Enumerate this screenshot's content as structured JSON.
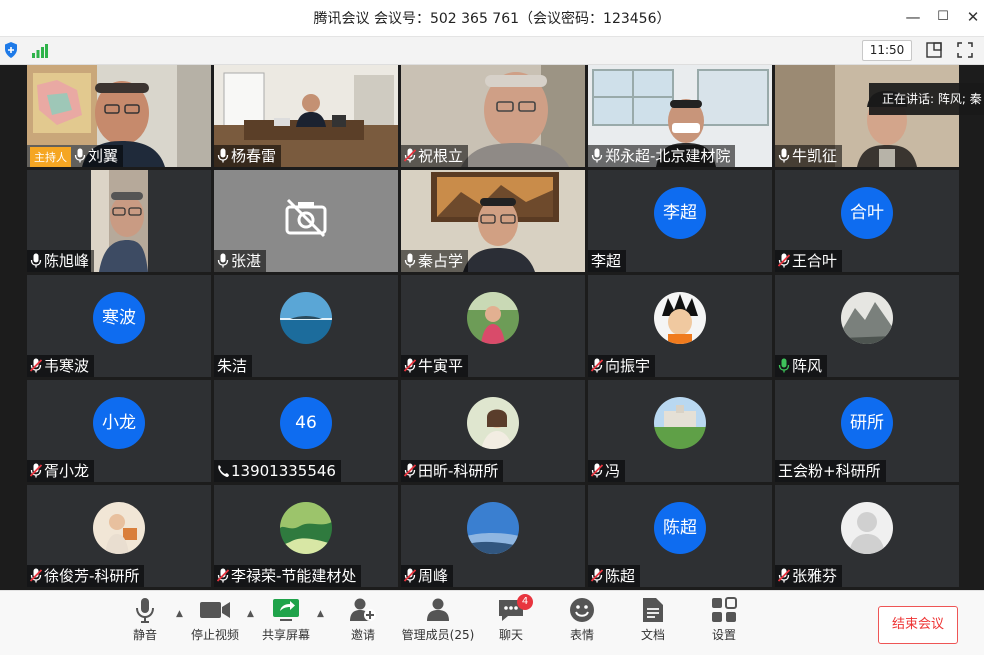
{
  "window": {
    "title": "腾讯会议 会议号：502 365 761（会议密码：123456）",
    "minimize": "—",
    "maximize": "☐",
    "close": "✕"
  },
  "infobar": {
    "time": "11:50"
  },
  "speaking_banner": "正在讲话: 阵风; 秦",
  "host_badge": "主持人",
  "tiles": [
    {
      "name": "刘翼",
      "mic": "on",
      "kind": "video",
      "scene": "office-map"
    },
    {
      "name": "杨春雷",
      "mic": "on",
      "kind": "video",
      "scene": "office-desk"
    },
    {
      "name": "祝根立",
      "mic": "muted",
      "kind": "video",
      "scene": "man-glasses"
    },
    {
      "name": "郑永超-北京建材院",
      "mic": "on",
      "kind": "video",
      "scene": "office-window"
    },
    {
      "name": "牛凯征",
      "mic": "on",
      "kind": "video",
      "scene": "man-room"
    },
    {
      "name": "陈旭峰",
      "mic": "on",
      "kind": "video",
      "scene": "man-shelf"
    },
    {
      "name": "张湛",
      "mic": "on",
      "kind": "camera-off"
    },
    {
      "name": "秦占学",
      "mic": "on",
      "kind": "video",
      "scene": "man-painting"
    },
    {
      "name": "李超",
      "mic": "none",
      "kind": "avatar",
      "avatar_text": "李超"
    },
    {
      "name": "王合叶",
      "mic": "muted",
      "kind": "avatar",
      "avatar_text": "合叶"
    },
    {
      "name": "韦寒波",
      "mic": "muted",
      "kind": "avatar",
      "avatar_text": "寒波"
    },
    {
      "name": "朱洁",
      "mic": "none",
      "kind": "photo",
      "photo": "lake"
    },
    {
      "name": "牛寅平",
      "mic": "muted",
      "kind": "photo",
      "photo": "girl"
    },
    {
      "name": "向振宇",
      "mic": "muted",
      "kind": "photo",
      "photo": "cartoon"
    },
    {
      "name": "阵风",
      "mic": "active",
      "kind": "photo",
      "photo": "mountain"
    },
    {
      "name": "胥小龙",
      "mic": "muted",
      "kind": "avatar",
      "avatar_text": "小龙"
    },
    {
      "name": "13901335546",
      "mic": "phone",
      "kind": "avatar",
      "avatar_text": "46"
    },
    {
      "name": "田昕-科研所",
      "mic": "muted",
      "kind": "photo",
      "photo": "woman"
    },
    {
      "name": "冯",
      "mic": "muted",
      "kind": "photo",
      "photo": "campus"
    },
    {
      "name": "王会粉+科研所",
      "mic": "none",
      "kind": "avatar",
      "avatar_text": "研所"
    },
    {
      "name": "徐俊芳-科研所",
      "mic": "muted",
      "kind": "photo",
      "photo": "child"
    },
    {
      "name": "李禄荣-节能建材处",
      "mic": "muted",
      "kind": "photo",
      "photo": "forest"
    },
    {
      "name": "周峰",
      "mic": "muted",
      "kind": "photo",
      "photo": "sky"
    },
    {
      "name": "陈超",
      "mic": "muted",
      "kind": "avatar",
      "avatar_text": "陈超"
    },
    {
      "name": "张雅芬",
      "mic": "muted",
      "kind": "photo",
      "photo": "default"
    }
  ],
  "toolbar": {
    "mute": "静音",
    "stop_video": "停止视频",
    "share_screen": "共享屏幕",
    "invite": "邀请",
    "manage_members": "管理成员(25)",
    "chat": "聊天",
    "chat_badge": "4",
    "reactions": "表情",
    "documents": "文档",
    "settings": "设置",
    "end_meeting": "结束会议"
  },
  "colors": {
    "avatar_blue": "#0e6cf0",
    "host_orange": "#f5a623",
    "mic_muted_red": "#e8353f",
    "mic_active_green": "#3ec35a",
    "end_red": "#e33333"
  }
}
